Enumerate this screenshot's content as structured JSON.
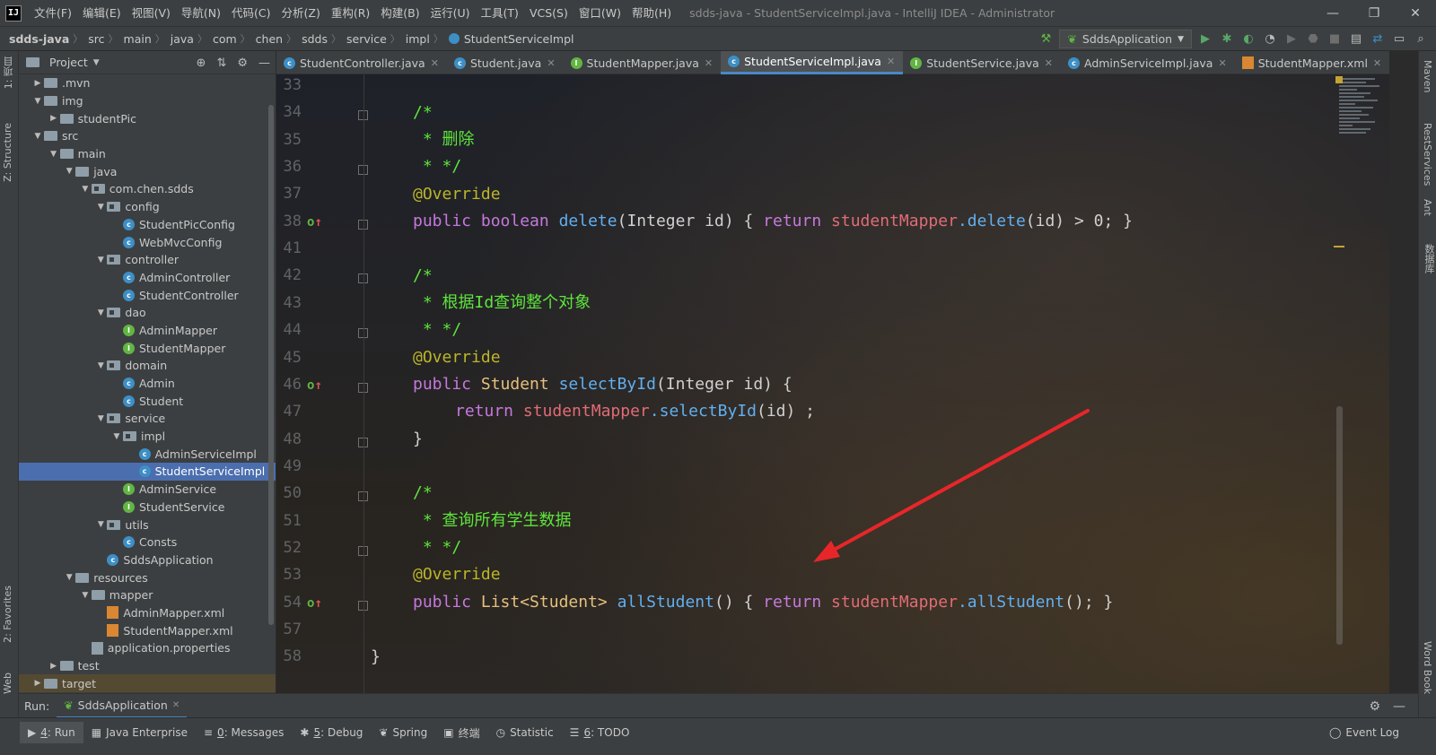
{
  "menubar": {
    "logo": "IJ",
    "items": [
      "文件(F)",
      "编辑(E)",
      "视图(V)",
      "导航(N)",
      "代码(C)",
      "分析(Z)",
      "重构(R)",
      "构建(B)",
      "运行(U)",
      "工具(T)",
      "VCS(S)",
      "窗口(W)",
      "帮助(H)"
    ],
    "window_title": "sdds-java - StudentServiceImpl.java - IntelliJ IDEA - Administrator",
    "minimize": "—",
    "maximize": "❐",
    "close": "✕"
  },
  "breadcrumb": [
    "sdds-java",
    "src",
    "main",
    "java",
    "com",
    "chen",
    "sdds",
    "service",
    "impl",
    "StudentServiceImpl"
  ],
  "nav": {
    "run_config": "SddsApplication"
  },
  "left_stripe": {
    "project_tab": "1: 项目",
    "structure_tab": "Z: Structure",
    "favorites_tab": "2: Favorites",
    "web_tab": "Web"
  },
  "right_stripe": {
    "maven": "Maven",
    "rest": "RestServices",
    "ant": "Ant",
    "db": "数据库",
    "wordbook": "Word Book"
  },
  "project": {
    "title": "Project",
    "tree": [
      {
        "label": ".mvn",
        "depth": 0,
        "arrow": "▶",
        "icon": "folder"
      },
      {
        "label": "img",
        "depth": 0,
        "arrow": "▼",
        "icon": "folder"
      },
      {
        "label": "studentPic",
        "depth": 1,
        "arrow": "▶",
        "icon": "folder"
      },
      {
        "label": "src",
        "depth": 0,
        "arrow": "▼",
        "icon": "folder"
      },
      {
        "label": "main",
        "depth": 1,
        "arrow": "▼",
        "icon": "folder"
      },
      {
        "label": "java",
        "depth": 2,
        "arrow": "▼",
        "icon": "folder"
      },
      {
        "label": "com.chen.sdds",
        "depth": 3,
        "arrow": "▼",
        "icon": "pkg"
      },
      {
        "label": "config",
        "depth": 4,
        "arrow": "▼",
        "icon": "pkg"
      },
      {
        "label": "StudentPicConfig",
        "depth": 5,
        "arrow": "",
        "icon": "c"
      },
      {
        "label": "WebMvcConfig",
        "depth": 5,
        "arrow": "",
        "icon": "c"
      },
      {
        "label": "controller",
        "depth": 4,
        "arrow": "▼",
        "icon": "pkg"
      },
      {
        "label": "AdminController",
        "depth": 5,
        "arrow": "",
        "icon": "c"
      },
      {
        "label": "StudentController",
        "depth": 5,
        "arrow": "",
        "icon": "c"
      },
      {
        "label": "dao",
        "depth": 4,
        "arrow": "▼",
        "icon": "pkg"
      },
      {
        "label": "AdminMapper",
        "depth": 5,
        "arrow": "",
        "icon": "i"
      },
      {
        "label": "StudentMapper",
        "depth": 5,
        "arrow": "",
        "icon": "i"
      },
      {
        "label": "domain",
        "depth": 4,
        "arrow": "▼",
        "icon": "pkg"
      },
      {
        "label": "Admin",
        "depth": 5,
        "arrow": "",
        "icon": "c"
      },
      {
        "label": "Student",
        "depth": 5,
        "arrow": "",
        "icon": "c"
      },
      {
        "label": "service",
        "depth": 4,
        "arrow": "▼",
        "icon": "pkg"
      },
      {
        "label": "impl",
        "depth": 5,
        "arrow": "▼",
        "icon": "pkg"
      },
      {
        "label": "AdminServiceImpl",
        "depth": 6,
        "arrow": "",
        "icon": "c"
      },
      {
        "label": "StudentServiceImpl",
        "depth": 6,
        "arrow": "",
        "icon": "c",
        "selected": true
      },
      {
        "label": "AdminService",
        "depth": 5,
        "arrow": "",
        "icon": "i"
      },
      {
        "label": "StudentService",
        "depth": 5,
        "arrow": "",
        "icon": "i"
      },
      {
        "label": "utils",
        "depth": 4,
        "arrow": "▼",
        "icon": "pkg"
      },
      {
        "label": "Consts",
        "depth": 5,
        "arrow": "",
        "icon": "c"
      },
      {
        "label": "SddsApplication",
        "depth": 4,
        "arrow": "",
        "icon": "c"
      },
      {
        "label": "resources",
        "depth": 2,
        "arrow": "▼",
        "icon": "folder"
      },
      {
        "label": "mapper",
        "depth": 3,
        "arrow": "▼",
        "icon": "folder"
      },
      {
        "label": "AdminMapper.xml",
        "depth": 4,
        "arrow": "",
        "icon": "xml"
      },
      {
        "label": "StudentMapper.xml",
        "depth": 4,
        "arrow": "",
        "icon": "xml"
      },
      {
        "label": "application.properties",
        "depth": 3,
        "arrow": "",
        "icon": "props"
      },
      {
        "label": "test",
        "depth": 1,
        "arrow": "▶",
        "icon": "folder"
      },
      {
        "label": "target",
        "depth": 0,
        "arrow": "▶",
        "icon": "folder",
        "highlight": true
      }
    ]
  },
  "tabs": [
    {
      "label": "StudentController.java",
      "icon": "c"
    },
    {
      "label": "Student.java",
      "icon": "c"
    },
    {
      "label": "StudentMapper.java",
      "icon": "i"
    },
    {
      "label": "StudentServiceImpl.java",
      "icon": "c",
      "active": true
    },
    {
      "label": "StudentService.java",
      "icon": "i"
    },
    {
      "label": "AdminServiceImpl.java",
      "icon": "c"
    },
    {
      "label": "StudentMapper.xml",
      "icon": "xml"
    }
  ],
  "editor": {
    "line_numbers": [
      "33",
      "34",
      "35",
      "36",
      "37",
      "38",
      "41",
      "42",
      "43",
      "44",
      "45",
      "46",
      "47",
      "48",
      "49",
      "50",
      "51",
      "52",
      "53",
      "54",
      "57",
      "58"
    ],
    "code": {
      "c34": "/*",
      "c35": " * 删除",
      "c36": " * */",
      "c37": "@Override",
      "c38_kw": "public",
      "c38_type": "boolean",
      "c38_fn": "delete",
      "c38_args": "(Integer id) { ",
      "c38_ret": "return",
      "c38_field": "studentMapper",
      "c38_call": ".delete",
      "c38_tail": "(id) > 0; }",
      "c42": "/*",
      "c43": " * 根据Id查询整个对象",
      "c44": " * */",
      "c45": "@Override",
      "c46_kw": "public",
      "c46_type": "Student",
      "c46_fn": "selectById",
      "c46_args": "(Integer id) {",
      "c47_ret": "return",
      "c47_field": "studentMapper",
      "c47_call": ".selectById",
      "c47_tail": "(id) ;",
      "c48": "}",
      "c50": "/*",
      "c51": " * 查询所有学生数据",
      "c52": " * */",
      "c53": "@Override",
      "c54_kw": "public",
      "c54_type": "List<Student>",
      "c54_fn": "allStudent",
      "c54_args": "() { ",
      "c54_ret": "return",
      "c54_field": "studentMapper",
      "c54_call": ".allStudent",
      "c54_tail": "(); }",
      "c58": "}"
    }
  },
  "runbar": {
    "label": "Run:",
    "tab": "SddsApplication"
  },
  "statusbar": {
    "items": [
      {
        "num": "4",
        "label": ": Run",
        "icon": "▶",
        "active": true
      },
      {
        "num": "",
        "label": "Java Enterprise",
        "icon": "▦"
      },
      {
        "num": "0",
        "label": ": Messages",
        "icon": "≡"
      },
      {
        "num": "5",
        "label": ": Debug",
        "icon": "✱"
      },
      {
        "num": "",
        "label": "Spring",
        "icon": "❦"
      },
      {
        "num": "",
        "label": "终端",
        "icon": "▣"
      },
      {
        "num": "",
        "label": "Statistic",
        "icon": "◷"
      },
      {
        "num": "6",
        "label": ": TODO",
        "icon": "☰"
      }
    ],
    "event_log": "Event Log"
  },
  "colors": {
    "accent": "#4a88c7",
    "selection": "#4b6eaf",
    "arrow": "#e8262a"
  }
}
